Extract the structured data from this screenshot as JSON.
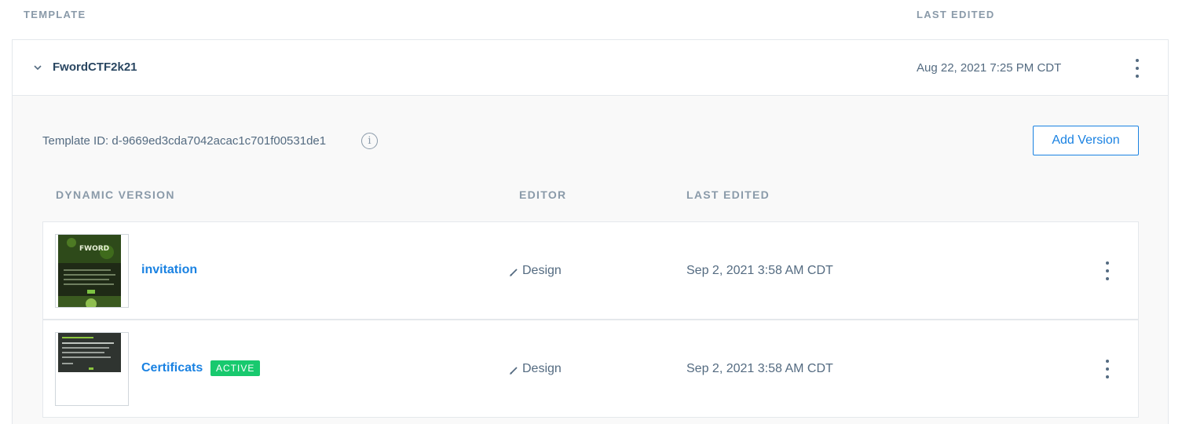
{
  "list_header": {
    "template_label": "TEMPLATE",
    "last_edited_label": "LAST EDITED"
  },
  "template": {
    "name": "FwordCTF2k21",
    "last_edited": "Aug 22, 2021 7:25 PM CDT",
    "id_text": "Template ID: d-9669ed3cda7042acac1c701f00531de1",
    "add_version_label": "Add Version",
    "icons": {
      "expand": "chevron-down-icon",
      "info": "info-icon",
      "menu": "kebab-menu-icon"
    }
  },
  "versions_header": {
    "dynamic_version": "DYNAMIC VERSION",
    "editor": "EDITOR",
    "last_edited": "LAST EDITED"
  },
  "versions": [
    {
      "name": "invitation",
      "badge": "",
      "editor": "Design",
      "last_edited": "Sep 2, 2021 3:58 AM CDT"
    },
    {
      "name": "Certificats",
      "badge": "ACTIVE",
      "editor": "Design",
      "last_edited": "Sep 2, 2021 3:58 AM CDT"
    }
  ],
  "colors": {
    "link": "#1a82e2",
    "active_badge": "#18c96e",
    "muted_text": "#8a9aa9",
    "border": "#e4e8ec"
  }
}
